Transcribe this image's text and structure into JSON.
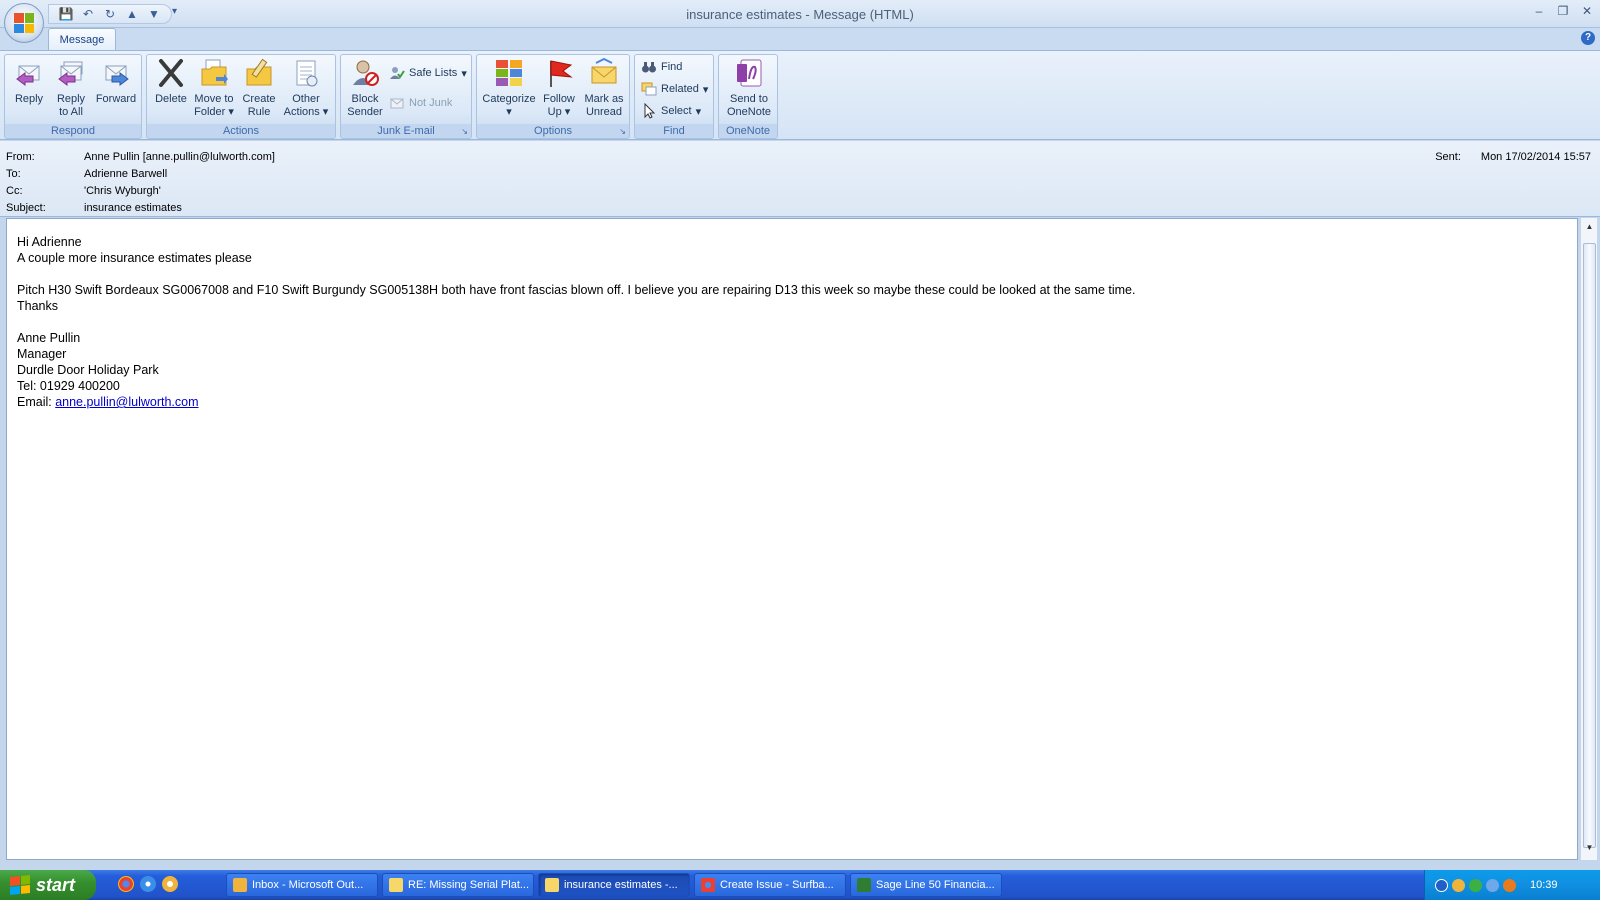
{
  "window": {
    "title": "insurance estimates - Message (HTML)"
  },
  "ribbon": {
    "tab": "Message",
    "groups": {
      "respond": {
        "label": "Respond",
        "reply": "Reply",
        "reply_all_1": "Reply",
        "reply_all_2": "to All",
        "forward": "Forward"
      },
      "actions": {
        "label": "Actions",
        "delete": "Delete",
        "move_1": "Move to",
        "move_2": "Folder",
        "create_1": "Create",
        "create_2": "Rule",
        "other_1": "Other",
        "other_2": "Actions"
      },
      "junk": {
        "label": "Junk E-mail",
        "block_1": "Block",
        "block_2": "Sender",
        "safe_lists": "Safe Lists",
        "not_junk": "Not Junk"
      },
      "options": {
        "label": "Options",
        "categorize": "Categorize",
        "follow_1": "Follow",
        "follow_2": "Up",
        "mark_1": "Mark as",
        "mark_2": "Unread"
      },
      "find": {
        "label": "Find",
        "find": "Find",
        "related": "Related",
        "select": "Select"
      },
      "onenote": {
        "label": "OneNote",
        "send_1": "Send to",
        "send_2": "OneNote"
      }
    }
  },
  "header": {
    "from_label": "From:",
    "from": "Anne Pullin [anne.pullin@lulworth.com]",
    "to_label": "To:",
    "to": "Adrienne Barwell",
    "cc_label": "Cc:",
    "cc": "'Chris Wyburgh'",
    "subject_label": "Subject:",
    "subject": "insurance estimates",
    "sent_label": "Sent:",
    "sent": "Mon 17/02/2014 15:57"
  },
  "body": {
    "greeting": "Hi Adrienne",
    "line1": "A couple more insurance estimates please",
    "line2": "Pitch H30  Swift Bordeaux SG0067008 and F10 Swift Burgundy  SG005138H both have front fascias blown off. I believe you are repairing D13 this week so maybe these could be looked at the same time.",
    "thanks": "Thanks",
    "sig_name": "Anne Pullin",
    "sig_title": "Manager",
    "sig_company": "Durdle Door Holiday Park",
    "sig_tel": "Tel: 01929 400200",
    "sig_email_label": "Email: ",
    "sig_email": "anne.pullin@lulworth.com"
  },
  "taskbar": {
    "start": "start",
    "tasks": [
      "Inbox - Microsoft Out...",
      "RE: Missing Serial Plat...",
      "insurance estimates -...",
      "Create Issue - Surfba...",
      "Sage Line 50 Financia..."
    ],
    "clock": "10:39"
  },
  "colors": {
    "ribbon_text": "#1e395b",
    "group_label": "#3e6aaa",
    "link": "#0000cc",
    "taskbar": "#245edb",
    "start": "#36902f"
  }
}
